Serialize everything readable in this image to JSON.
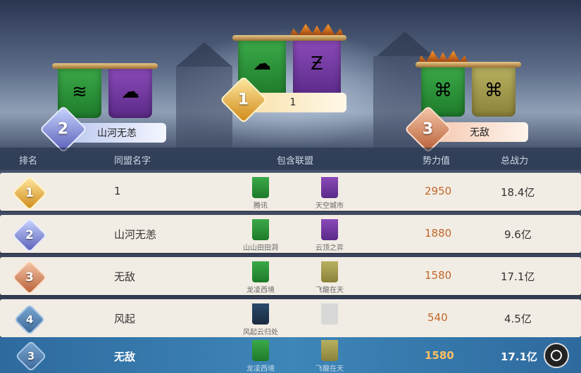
{
  "podium": {
    "first": {
      "rank": "1",
      "name": "1"
    },
    "second": {
      "rank": "2",
      "name": "山河无恙"
    },
    "third": {
      "rank": "3",
      "name": "无敌"
    }
  },
  "table": {
    "headers": [
      "排名",
      "同盟名字",
      "包含联盟",
      "势力值",
      "总战力"
    ],
    "rows": [
      {
        "rank": "1",
        "name": "1",
        "alliances": [
          "腾讯",
          "天空城市"
        ],
        "power": "2950",
        "total": "18.4亿"
      },
      {
        "rank": "2",
        "name": "山河无恙",
        "alliances": [
          "山山田田洞",
          "云顶之弈"
        ],
        "power": "1880",
        "total": "9.6亿"
      },
      {
        "rank": "3",
        "name": "无敌",
        "alliances": [
          "龙凌西境",
          "飞龍在天"
        ],
        "power": "1580",
        "total": "17.1亿"
      },
      {
        "rank": "4",
        "name": "风起",
        "alliances": [
          "风起云归处",
          ""
        ],
        "power": "540",
        "total": "4.5亿"
      }
    ],
    "self": {
      "rank": "3",
      "name": "无敌",
      "alliances": [
        "龙凌西境",
        "飞龍在天"
      ],
      "power": "1580",
      "total": "17.1亿"
    }
  },
  "icons": [
    "camera-icon",
    "banner-icon",
    "crown-icon"
  ],
  "colors": {
    "power": "#c0652a",
    "self_power": "#ffc060",
    "highlight": "#3e86b8"
  }
}
